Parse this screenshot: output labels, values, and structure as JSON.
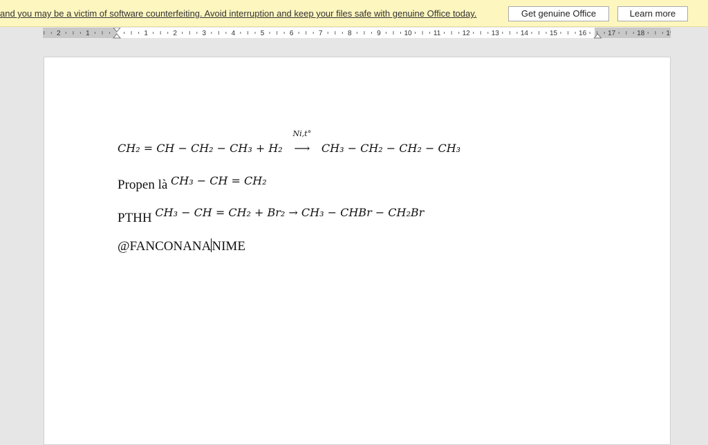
{
  "banner": {
    "message": "and you may be a victim of software counterfeiting. Avoid interruption and keep your files safe with genuine Office today.",
    "get_genuine_label": "Get genuine Office",
    "learn_more_label": "Learn more"
  },
  "ruler": {
    "left_numbers": [
      "2",
      "1"
    ],
    "right_numbers": [
      "1",
      "2",
      "3",
      "4",
      "5",
      "6",
      "7",
      "8",
      "9",
      "10",
      "11",
      "12",
      "13",
      "14",
      "15",
      "16",
      "17",
      "18",
      "19"
    ]
  },
  "document": {
    "eq1": {
      "left": "CH₂ = CH − CH₂ − CH₃ + H₂",
      "condition": "Ni,t°",
      "right": "CH₃ − CH₂ − CH₂ − CH₃"
    },
    "line2_text": "Propen là",
    "line2_math": "CH₃ − CH = CH₂",
    "line3_text": "PTHH",
    "line3_math": "CH₃ − CH = CH₂ + Br₂ → CH₃ − CHBr − CH₂Br",
    "line4_before_caret": "@FANCONANA",
    "line4_after_caret": "NIME"
  }
}
